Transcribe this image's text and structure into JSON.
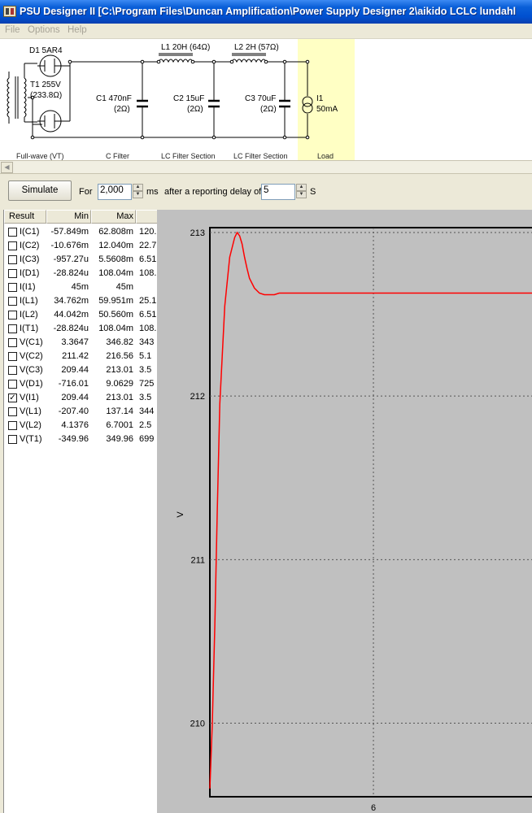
{
  "window": {
    "title": "PSU Designer II  [C:\\Program Files\\Duncan Amplification\\Power Supply Designer 2\\aikido LCLC lundahl"
  },
  "menu": [
    "File",
    "Options",
    "Help"
  ],
  "schematic": {
    "rectifier": {
      "name": "D1 5AR4",
      "section": "Full-wave (VT)"
    },
    "transformer": {
      "name": "T1 255V",
      "resistance": "(233.8Ω)"
    },
    "c1": {
      "name": "C1 470nF",
      "esr": "(2Ω)",
      "section": "C Filter"
    },
    "l1": {
      "name": "L1 20H (64Ω)"
    },
    "c2": {
      "name": "C2 15uF",
      "esr": "(2Ω)",
      "section": "LC Filter Section"
    },
    "l2": {
      "name": "L2 2H (57Ω)"
    },
    "c3": {
      "name": "C3 70uF",
      "esr": "(2Ω)",
      "section": "LC Filter Section"
    },
    "load": {
      "name": "I1",
      "value": "50mA",
      "section": "Load"
    }
  },
  "simulation": {
    "button": "Simulate",
    "for_label": "For",
    "duration": "2,000",
    "ms_label": "ms",
    "delay_label": "after a reporting delay of",
    "delay": "5",
    "s_label": "S"
  },
  "results": {
    "columns": [
      "Result",
      "Min",
      "Max"
    ],
    "rows": [
      {
        "name": "I(C1)",
        "min": "-57.849m",
        "max": "62.808m",
        "extra": "120.",
        "checked": false
      },
      {
        "name": "I(C2)",
        "min": "-10.676m",
        "max": "12.040m",
        "extra": "22.7",
        "checked": false
      },
      {
        "name": "I(C3)",
        "min": "-957.27u",
        "max": "5.5608m",
        "extra": "6.51",
        "checked": false
      },
      {
        "name": "I(D1)",
        "min": "-28.824u",
        "max": "108.04m",
        "extra": "108.",
        "checked": false
      },
      {
        "name": "I(I1)",
        "min": "45m",
        "max": "45m",
        "extra": "",
        "checked": false
      },
      {
        "name": "I(L1)",
        "min": "34.762m",
        "max": "59.951m",
        "extra": "25.1",
        "checked": false
      },
      {
        "name": "I(L2)",
        "min": "44.042m",
        "max": "50.560m",
        "extra": "6.51",
        "checked": false
      },
      {
        "name": "I(T1)",
        "min": "-28.824u",
        "max": "108.04m",
        "extra": "108.",
        "checked": false
      },
      {
        "name": "V(C1)",
        "min": "3.3647",
        "max": "346.82",
        "extra": "343",
        "checked": false
      },
      {
        "name": "V(C2)",
        "min": "211.42",
        "max": "216.56",
        "extra": "5.1",
        "checked": false
      },
      {
        "name": "V(C3)",
        "min": "209.44",
        "max": "213.01",
        "extra": "3.5",
        "checked": false
      },
      {
        "name": "V(D1)",
        "min": "-716.01",
        "max": "9.0629",
        "extra": "725",
        "checked": false
      },
      {
        "name": "V(I1)",
        "min": "209.44",
        "max": "213.01",
        "extra": "3.5",
        "checked": true
      },
      {
        "name": "V(L1)",
        "min": "-207.40",
        "max": "137.14",
        "extra": "344",
        "checked": false
      },
      {
        "name": "V(L2)",
        "min": "4.1376",
        "max": "6.7001",
        "extra": "2.5",
        "checked": false
      },
      {
        "name": "V(T1)",
        "min": "-349.96",
        "max": "349.96",
        "extra": "699",
        "checked": false
      }
    ]
  },
  "chart_data": {
    "type": "line",
    "title": "",
    "xlabel": "",
    "ylabel": "V",
    "ylim": [
      209.55,
      213.03
    ],
    "xlim": [
      2.7,
      9.2
    ],
    "yticks": [
      210,
      211,
      212,
      213
    ],
    "xticks": [
      6
    ],
    "ytick_labels": [
      "210",
      "211",
      "212",
      "213"
    ],
    "xtick_labels": [
      "6"
    ],
    "grid": true,
    "line_color": "#ff0000",
    "series": [
      {
        "x": [
          2.7,
          2.75,
          2.8,
          2.85,
          2.9,
          3.0,
          3.1,
          3.2,
          3.25,
          3.3,
          3.35,
          3.4,
          3.45,
          3.5,
          3.6,
          3.7,
          3.8,
          3.9,
          4.0,
          4.1,
          4.2,
          4.4,
          4.6,
          5.0,
          5.5,
          6.0,
          6.5,
          7.0,
          7.5,
          8.0,
          8.5,
          9.0,
          9.2
        ],
        "y": [
          209.6,
          210.0,
          210.6,
          211.3,
          211.95,
          212.55,
          212.85,
          212.97,
          213.0,
          212.98,
          212.93,
          212.85,
          212.78,
          212.72,
          212.66,
          212.63,
          212.62,
          212.62,
          212.62,
          212.63,
          212.63,
          212.63,
          212.63,
          212.63,
          212.63,
          212.63,
          212.63,
          212.63,
          212.63,
          212.63,
          212.63,
          212.63,
          212.63
        ]
      }
    ]
  }
}
